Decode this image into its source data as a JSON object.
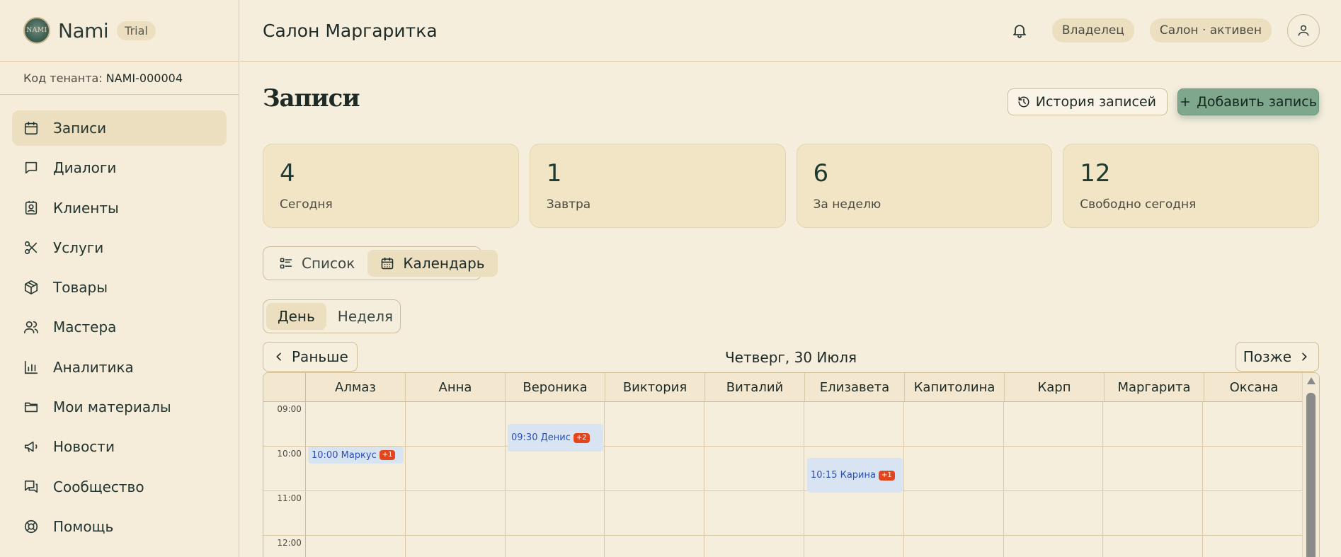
{
  "brand": {
    "name": "Nami",
    "logo_text": "NAMI",
    "badge": "Trial"
  },
  "tenant": {
    "label": "Код тенанта:",
    "code": "NAMI-000004"
  },
  "nav": [
    {
      "label": "Записи",
      "icon": "calendar-icon",
      "active": true
    },
    {
      "label": "Диалоги",
      "icon": "chat-icon"
    },
    {
      "label": "Клиенты",
      "icon": "contact-icon"
    },
    {
      "label": "Услуги",
      "icon": "scissors-icon"
    },
    {
      "label": "Товары",
      "icon": "box-icon"
    },
    {
      "label": "Мастера",
      "icon": "users-icon"
    },
    {
      "label": "Аналитика",
      "icon": "chart-icon"
    },
    {
      "label": "Мои материалы",
      "icon": "folder-icon"
    },
    {
      "label": "Новости",
      "icon": "megaphone-icon"
    },
    {
      "label": "Сообщество",
      "icon": "messages-icon"
    },
    {
      "label": "Помощь",
      "icon": "lifebuoy-icon"
    }
  ],
  "header": {
    "salon_name": "Салон Маргаритка",
    "role": "Владелец",
    "status": "Салон · активен"
  },
  "page": {
    "title": "Записи",
    "history_button": "История записей",
    "add_button": "Добавить запись"
  },
  "stats": [
    {
      "value": "4",
      "label": "Сегодня"
    },
    {
      "value": "1",
      "label": "Завтра"
    },
    {
      "value": "6",
      "label": "За неделю"
    },
    {
      "value": "12",
      "label": "Свободно сегодня"
    }
  ],
  "view_toggle": {
    "list": "Список",
    "calendar": "Календарь",
    "selected": "calendar"
  },
  "range_toggle": {
    "day": "День",
    "week": "Неделя",
    "selected": "day"
  },
  "date_nav": {
    "prev": "Раньше",
    "next": "Позже",
    "date": "Четверг, 30 Июля"
  },
  "calendar": {
    "masters": [
      "Алмаз",
      "Анна",
      "Вероника",
      "Виктория",
      "Виталий",
      "Елизавета",
      "Капитолина",
      "Карп",
      "Маргарита",
      "Оксана"
    ],
    "times": [
      "09:00",
      "10:00",
      "11:00",
      "12:00"
    ],
    "events": [
      {
        "text": "10:00 Маркус",
        "more": "+1",
        "master": "Алмаз"
      },
      {
        "text": "09:30 Денис",
        "more": "+2",
        "master": "Вероника"
      },
      {
        "text": "10:15 Карина",
        "more": "+1",
        "master": "Елизавета"
      }
    ]
  },
  "colors": {
    "accent": "#7ea78d",
    "background": "#f6eedd",
    "card": "#f1e5c6",
    "event_bg": "#d9e4f2",
    "badge": "#e2461c"
  }
}
